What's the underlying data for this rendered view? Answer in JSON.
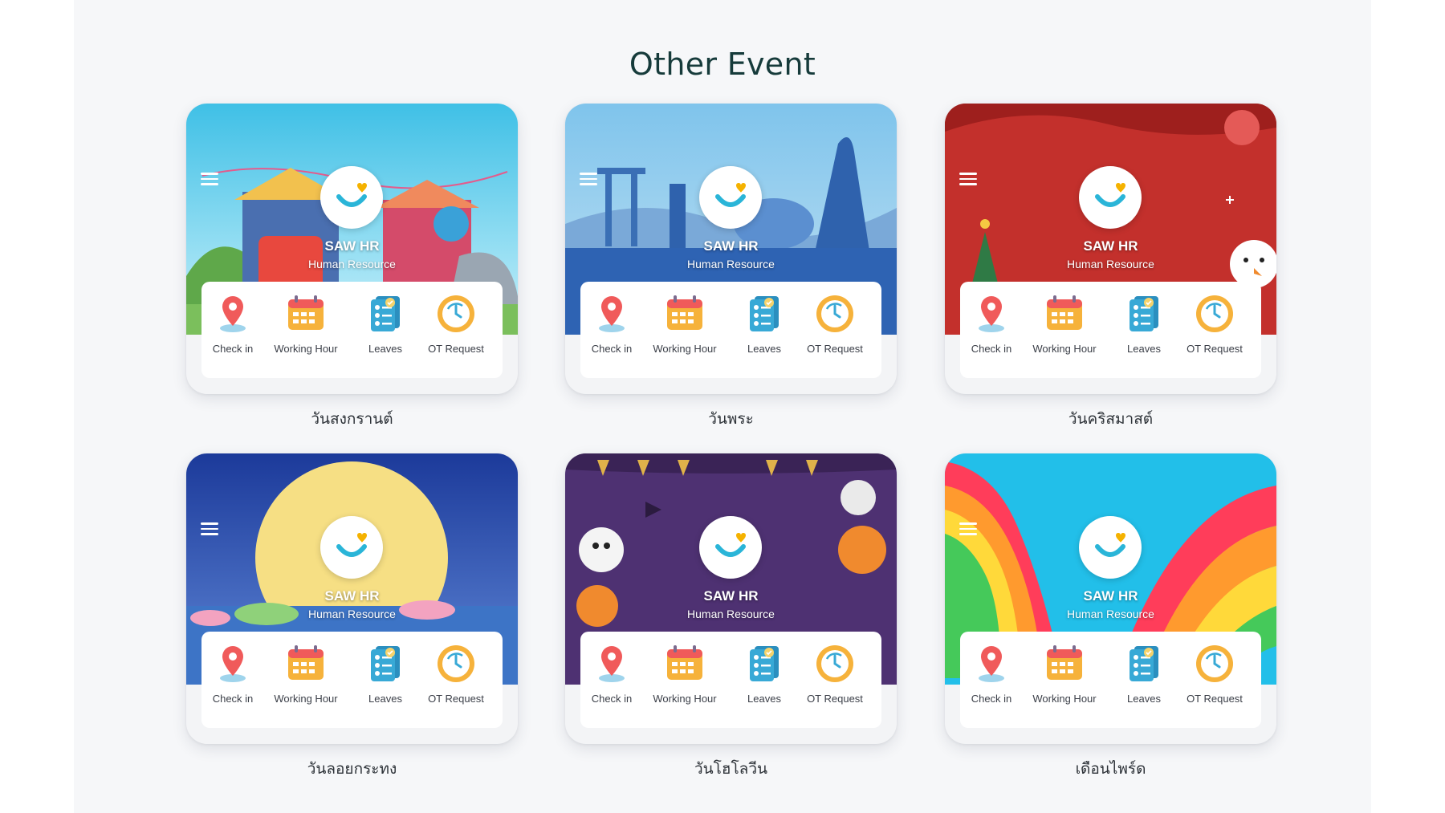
{
  "page_title": "Other Event",
  "app": {
    "brand": "SAW HR",
    "subtitle": "Human Resource",
    "menu": [
      {
        "label": "Check in",
        "icon": "map-pin-icon"
      },
      {
        "label": "Working Hour",
        "icon": "calendar-icon"
      },
      {
        "label": "Leaves",
        "icon": "checklist-clipboard-icon"
      },
      {
        "label": "OT Request",
        "icon": "clock-refresh-icon"
      }
    ]
  },
  "events": [
    {
      "caption": "วันสงกรานต์",
      "theme": "songkran",
      "colors": [
        "#4cc6e6",
        "#b9ecf7"
      ]
    },
    {
      "caption": "วันพระ",
      "theme": "buddhist-day",
      "colors": [
        "#6fb8e6",
        "#2f6fb8"
      ]
    },
    {
      "caption": "วันคริสมาสต์",
      "theme": "christmas",
      "colors": [
        "#c7302b",
        "#9e1e1c"
      ]
    },
    {
      "caption": "วันลอยกระทง",
      "theme": "loy-krathong",
      "colors": [
        "#1f3f9e",
        "#f6e08a"
      ]
    },
    {
      "caption": "วันโฮโลวีน",
      "theme": "halloween",
      "colors": [
        "#4b2f6e",
        "#6a3f8e"
      ]
    },
    {
      "caption": "เดือนไพร์ด",
      "theme": "pride-month",
      "colors": [
        "#1ec0ea",
        "#ff3d5a"
      ]
    }
  ],
  "icon_colors": {
    "pin": "#f05a5a",
    "calendar": "#f6b23b",
    "clipboard": "#38a9d6",
    "clock": "#f6b23b"
  }
}
